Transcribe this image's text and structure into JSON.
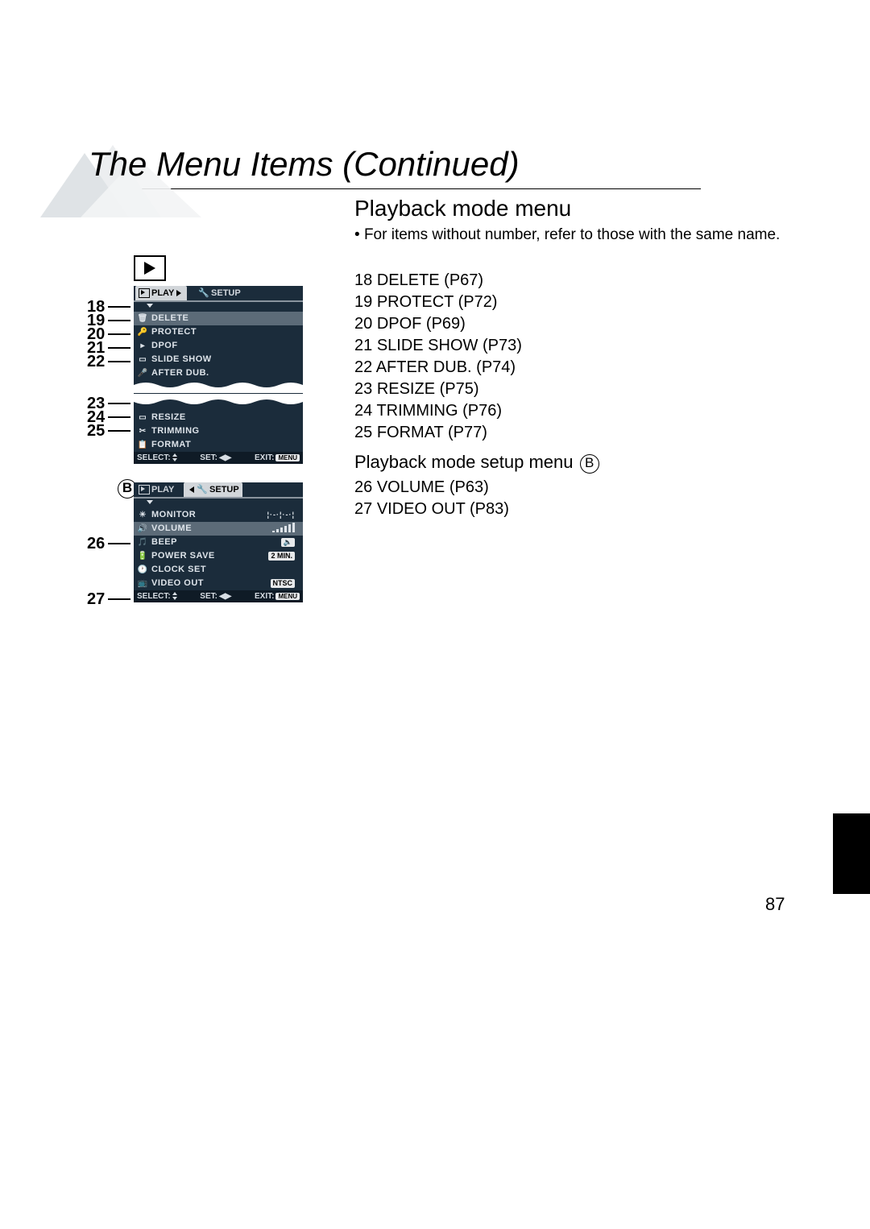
{
  "title": "The Menu Items (Continued)",
  "subtitle": "Playback mode menu",
  "note_bullet": "•",
  "note": "For items without number, refer to those with the same name.",
  "playback_items": [
    {
      "n": "18",
      "label": "DELETE (P67)"
    },
    {
      "n": "19",
      "label": "PROTECT (P72)"
    },
    {
      "n": "20",
      "label": "DPOF (P69)"
    },
    {
      "n": "21",
      "label": "SLIDE SHOW (P73)"
    },
    {
      "n": "22",
      "label": "AFTER DUB. (P74)"
    },
    {
      "n": "23",
      "label": "RESIZE (P75)"
    },
    {
      "n": "24",
      "label": "TRIMMING (P76)"
    },
    {
      "n": "25",
      "label": "FORMAT (P77)"
    }
  ],
  "setup_heading": "Playback mode setup menu",
  "setup_badge": "B",
  "setup_items": [
    {
      "n": "26",
      "label": "VOLUME (P63)"
    },
    {
      "n": "27",
      "label": "VIDEO OUT (P83)"
    }
  ],
  "panel_a": {
    "tab_play": "PLAY",
    "tab_setup": "SETUP",
    "rows_top": [
      {
        "label": "DELETE",
        "icon": "🗑"
      },
      {
        "label": "PROTECT",
        "icon": "🔑"
      },
      {
        "label": "DPOF",
        "icon": "▸"
      },
      {
        "label": "SLIDE SHOW",
        "icon": "▭"
      },
      {
        "label": "AFTER DUB.",
        "icon": "🎤"
      }
    ],
    "rows_bottom": [
      {
        "label": "RESIZE",
        "icon": "▭"
      },
      {
        "label": "TRIMMING",
        "icon": "✂"
      },
      {
        "label": "FORMAT",
        "icon": "📋"
      }
    ],
    "footer": {
      "select": "SELECT:",
      "set": "SET:",
      "exit": "EXIT:",
      "menu": "MENU"
    }
  },
  "panel_b": {
    "tab_play": "PLAY",
    "tab_setup": "SETUP",
    "rows": [
      {
        "label": "MONITOR",
        "icon": "☀",
        "val_type": "slider"
      },
      {
        "label": "VOLUME",
        "icon": "🔊",
        "val_type": "bars"
      },
      {
        "label": "BEEP",
        "icon": "🎵",
        "val_type": "beep"
      },
      {
        "label": "POWER SAVE",
        "icon": "🔋",
        "badge": "2 MIN."
      },
      {
        "label": "CLOCK SET",
        "icon": "🕐"
      },
      {
        "label": "VIDEO OUT",
        "icon": "📺",
        "badge": "NTSC"
      }
    ],
    "footer": {
      "select": "SELECT:",
      "set": "SET:",
      "exit": "EXIT:",
      "menu": "MENU"
    }
  },
  "diagram_b_label": "B",
  "page_number": "87"
}
